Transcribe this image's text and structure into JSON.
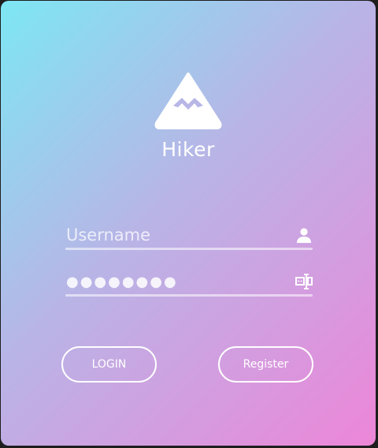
{
  "app": {
    "title": "Hiker",
    "logo_icon": "mountain-icon"
  },
  "login_form": {
    "username": {
      "placeholder": "Username",
      "value": "",
      "icon": "user-icon"
    },
    "password": {
      "value": "●●●●●●●●",
      "icon": "password-field-icon"
    },
    "login_label": "LOGIN",
    "register_label": "Register"
  },
  "colors": {
    "gradient_start": "#7de7f3",
    "gradient_mid": "#b9b4e6",
    "gradient_end": "#ed86d8",
    "foreground": "#ffffff"
  }
}
